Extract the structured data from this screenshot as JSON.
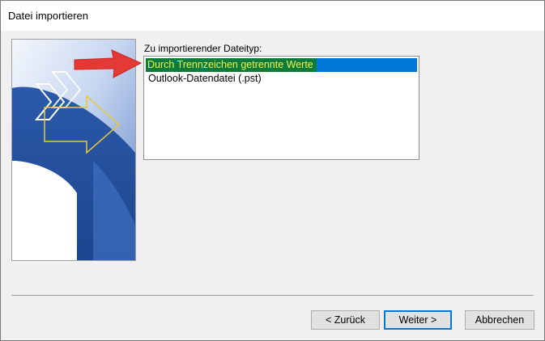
{
  "window": {
    "title": "Datei importieren"
  },
  "import": {
    "label": "Zu importierender Dateityp:",
    "items": [
      {
        "label": "Durch Trennzeichen getrennte Werte",
        "selected": true
      },
      {
        "label": "Outlook-Datendatei (.pst)",
        "selected": false
      }
    ]
  },
  "buttons": {
    "back": "< Zurück",
    "next": "Weiter >",
    "cancel": "Abbrechen"
  },
  "colors": {
    "selection": "#0078d7",
    "highlight_bg": "#0d7b3c",
    "highlight_text": "#f4f14a",
    "annotation_arrow": "#e53935"
  },
  "icons": {
    "annotation": "red-pointer-arrow-icon"
  }
}
